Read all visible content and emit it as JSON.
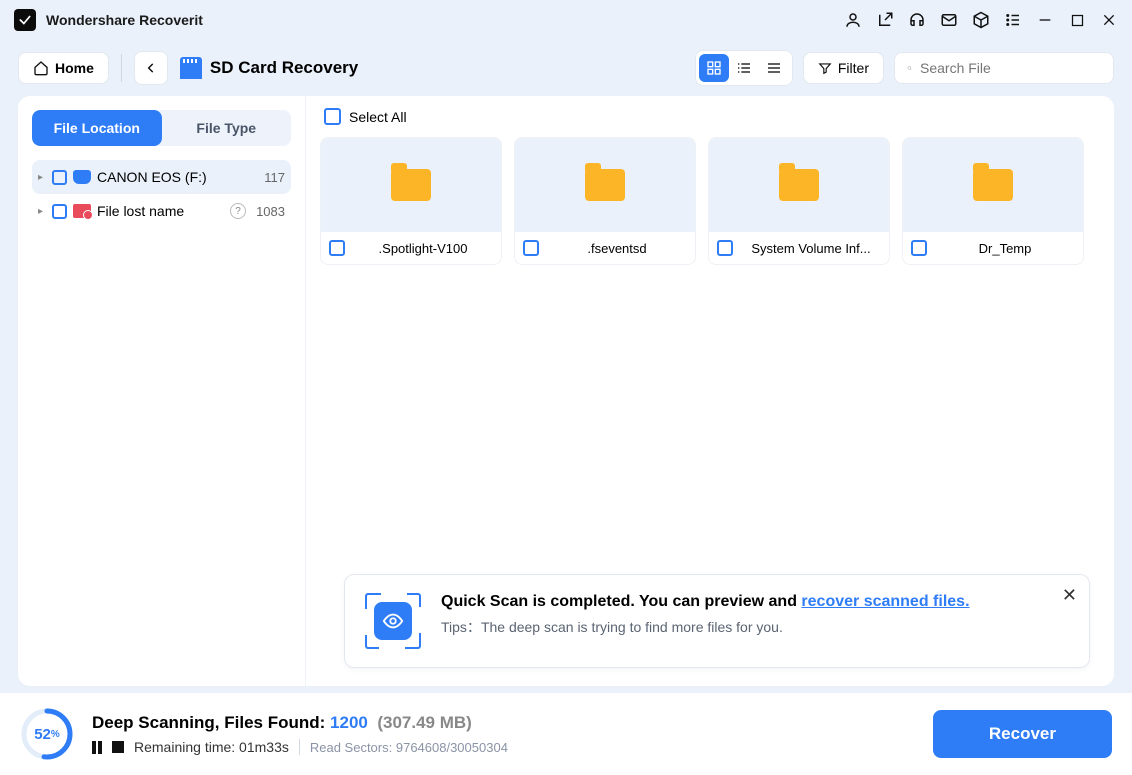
{
  "app": {
    "title": "Wondershare Recoverit"
  },
  "toolbar": {
    "home": "Home",
    "breadcrumb": "SD Card Recovery",
    "filter": "Filter",
    "search_placeholder": "Search File"
  },
  "sidebar": {
    "tabs": {
      "location": "File Location",
      "type": "File Type"
    },
    "items": [
      {
        "label": "CANON EOS (F:)",
        "count": "117"
      },
      {
        "label": "File lost name",
        "count": "1083"
      }
    ]
  },
  "content": {
    "select_all": "Select All",
    "folders": [
      {
        "name": ".Spotlight-V100"
      },
      {
        "name": ".fseventsd"
      },
      {
        "name": "System Volume Inf..."
      },
      {
        "name": "Dr_Temp"
      }
    ]
  },
  "notice": {
    "title_pre": "Quick Scan is completed. You can preview and ",
    "title_link": "recover scanned files.",
    "tips_label": "Tips：",
    "tips_text": "The deep scan is trying to find more files for you."
  },
  "footer": {
    "progress_percent": "52",
    "scan_label": "Deep Scanning, Files Found: ",
    "files_found": "1200",
    "size": "(307.49 MB)",
    "remaining_label": "Remaining time: ",
    "remaining_value": "01m33s",
    "sectors_label": "Read Sectors: ",
    "sectors_value": "9764608/30050304",
    "recover": "Recover"
  }
}
